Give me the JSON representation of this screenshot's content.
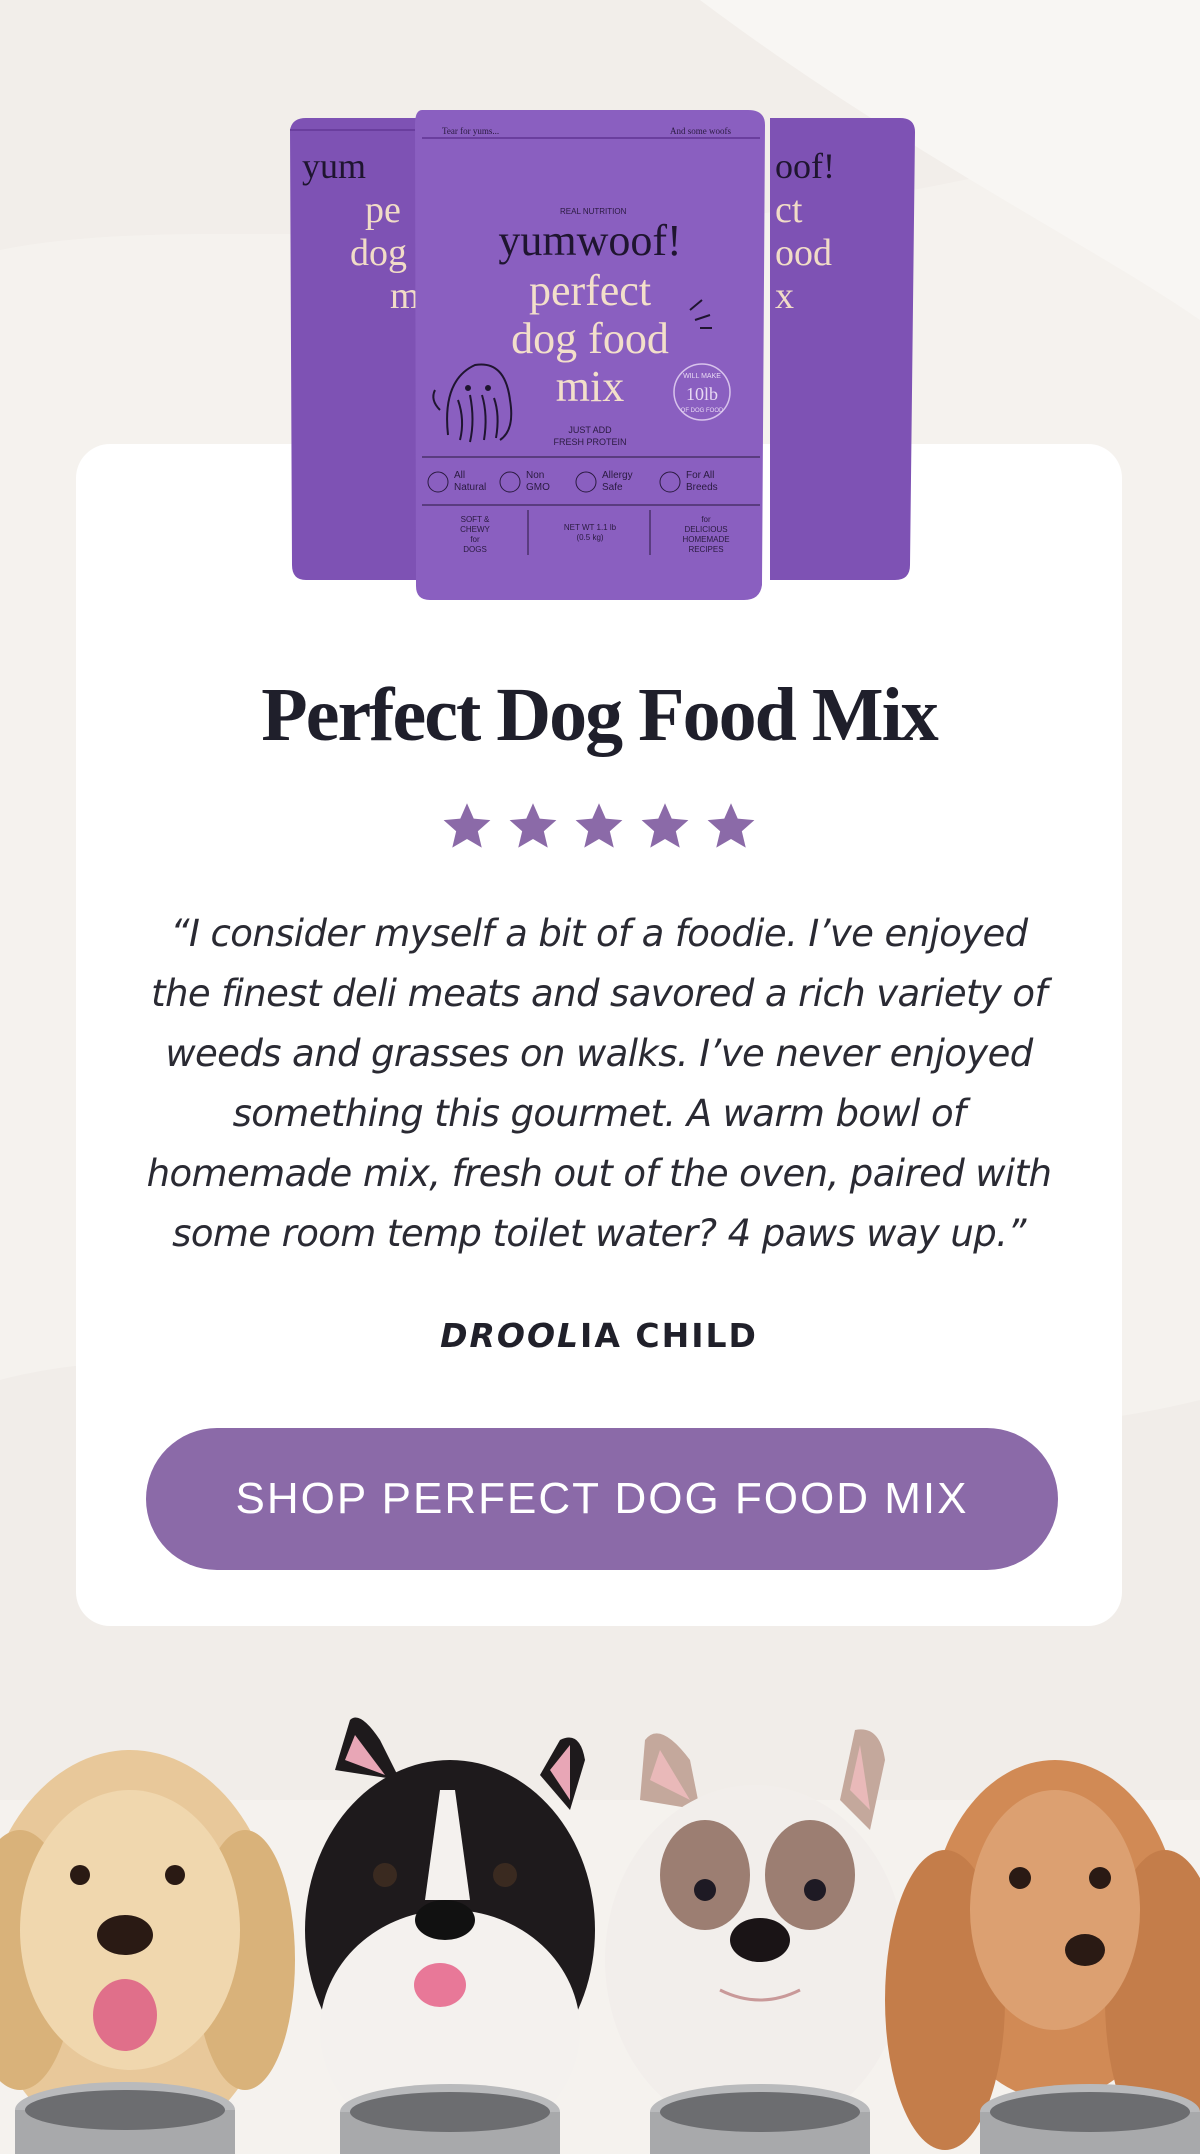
{
  "product": {
    "title": "Perfect Dog Food Mix",
    "rating": 5,
    "rating_max": 5
  },
  "testimonial": {
    "quote": "“I consider myself a bit of a foodie. I’ve enjoyed the finest deli meats and savored a rich variety of weeds and grasses on walks. I’ve never enjoyed something this gourmet. A warm bowl of homemade mix, fresh out of the oven, paired with some room temp toilet water? 4 paws way up.”",
    "author_part1": "DROOL",
    "author_part2": "IA CHILD"
  },
  "cta": {
    "label": "SHOP PERFECT DOG FOOD MIX"
  },
  "packaging": {
    "top_left": "Tear for yums...",
    "top_right": "And some woofs",
    "arc": "REAL NUTRITION",
    "brand": "yumwoof!",
    "name_line1": "perfect",
    "name_line2": "dog food",
    "name_line3": "mix",
    "just_add": "JUST ADD",
    "fresh_protein": "FRESH PROTEIN",
    "badge_will_make": "WILL MAKE",
    "badge_weight": "10lb",
    "badge_dog_food": "OF DOG FOOD",
    "icon_all": "All",
    "icon_natural": "Natural",
    "icon_non": "Non",
    "icon_gmo": "GMO",
    "icon_allergy": "Allergy",
    "icon_safe": "Safe",
    "icon_forall": "For All",
    "icon_breeds": "Breeds",
    "soft1": "SOFT &",
    "soft2": "CHEWY",
    "soft3": "for",
    "soft4": "DOGS",
    "net1": "NET WT 1.1 lb",
    "net2": "(0.5 kg)",
    "for1": "for",
    "for2": "DELICIOUS",
    "for3": "HOMEMADE",
    "for4": "RECIPES"
  },
  "colors": {
    "accent": "#8b6aa8",
    "bag": "#8a5fc0",
    "background": "#f5f2ee",
    "card": "#ffffff"
  }
}
